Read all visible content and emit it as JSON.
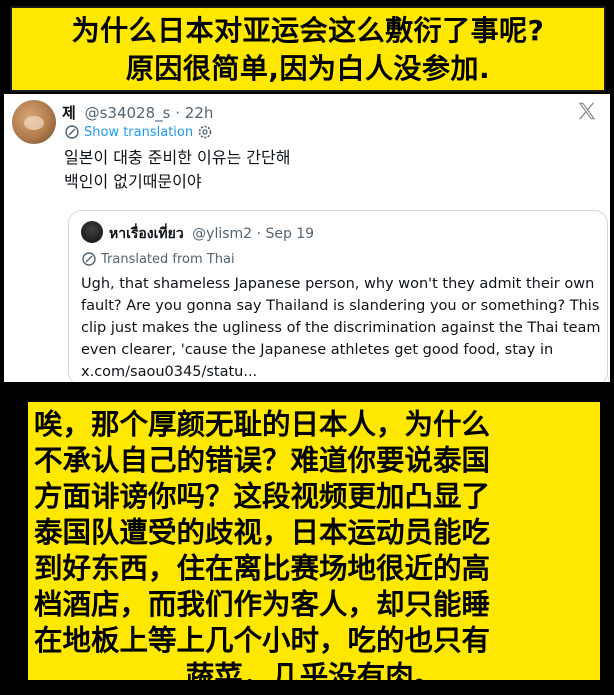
{
  "top_caption": {
    "line1": "为什么日本对亚运会这么敷衍了事呢?",
    "line2": "原因很简单,因为白人没参加."
  },
  "tweet": {
    "display_name": "제",
    "handle": "@s34028_s",
    "separator": "·",
    "time": "22h",
    "show_translation": "Show translation",
    "body_lines": [
      "일본이 대충 준비한 이유는 간단해",
      "백인이 없기때문이야"
    ],
    "quote": {
      "display_name": "หาเรื่องเที่ยว",
      "handle": "@ylism2",
      "separator": "·",
      "date": "Sep 19",
      "translated_from": "Translated from Thai",
      "body_lines": [
        "Ugh, that shameless Japanese person, why won't they admit their own",
        "fault? Are you gonna say Thailand is slandering you or something? This",
        "clip just makes the ugliness of the discrimination against the Thai team",
        "even clearer, 'cause the Japanese athletes get good food, stay in",
        "x.com/saou0345/statu..."
      ]
    }
  },
  "bottom_caption": {
    "lines": [
      "唉，那个厚颜无耻的日本人，为什么",
      "不承认自己的错误？难道你要说泰国",
      "方面诽谤你吗？这段视频更加凸显了",
      "泰国队遭受的歧视，日本运动员能吃",
      "到好东西，住在离比赛场地很近的高",
      "档酒店，而我们作为客人，却只能睡",
      "在地板上等上几个小时，吃的也只有",
      "蔬菜，几乎没有肉。"
    ]
  },
  "icons": {
    "x_logo": "x-logo-icon",
    "translate": "translate-icon",
    "settings": "gear-icon"
  },
  "colors": {
    "caption_bg": "#FFE800",
    "link_blue": "#1d9bf0",
    "meta_grey": "#536471"
  }
}
